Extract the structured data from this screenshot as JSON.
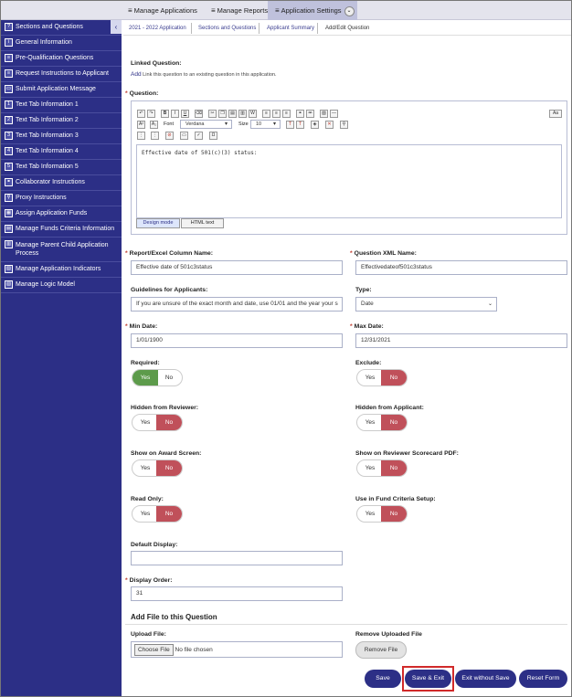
{
  "nav": {
    "tabs": [
      {
        "label": "Manage Applications"
      },
      {
        "label": "Manage Reports"
      },
      {
        "label": "Application Settings"
      }
    ]
  },
  "sidebar": {
    "items": [
      {
        "label": "Sections and Questions",
        "icon": "?"
      },
      {
        "label": "General Information",
        "icon": "i"
      },
      {
        "label": "Pre-Qualification Questions",
        "icon": "≡"
      },
      {
        "label": "Request Instructions to Applicant",
        "icon": "≡"
      },
      {
        "label": "Submit Application Message",
        "icon": "▭"
      },
      {
        "label": "Text Tab Information 1",
        "icon": "1"
      },
      {
        "label": "Text Tab Information 2",
        "icon": "2"
      },
      {
        "label": "Text Tab Information 3",
        "icon": "3"
      },
      {
        "label": "Text Tab Information 4",
        "icon": "4"
      },
      {
        "label": "Text Tab Information 5",
        "icon": "5"
      },
      {
        "label": "Collaborator Instructions",
        "icon": "⚭"
      },
      {
        "label": "Proxy Instructions",
        "icon": "⚲"
      },
      {
        "label": "Assign Application Funds",
        "icon": "▦"
      },
      {
        "label": "Manage Funds Criteria Information",
        "icon": "▤"
      },
      {
        "label": "Manage Parent Child Application Process",
        "icon": "▥"
      },
      {
        "label": "Manage Application Indicators",
        "icon": "▨"
      },
      {
        "label": "Manage Logic Model",
        "icon": "▧"
      }
    ]
  },
  "breadcrumb": [
    "2021 - 2022 Application",
    "Sections and Questions",
    "Applicant Summary",
    "Add/Edit Question"
  ],
  "linked": {
    "label": "Linked Question:",
    "add": "Add",
    "note": "Link this question to an existing question in this application."
  },
  "question": {
    "label": "Question:",
    "text": "Effective date of 501(c)(3) status:",
    "font": "Verdana",
    "size": "10",
    "font_label": "Font",
    "size_label": "Size",
    "design_mode": "Design mode",
    "html_text": "HTML text",
    "aa": "Aa"
  },
  "fields": {
    "report_label": "Report/Excel Column Name:",
    "report_value": "Effective date of 501c3status",
    "xml_label": "Question XML Name:",
    "xml_value": "Effectivedateof501c3status",
    "guide_label": "Guidelines for Applicants:",
    "guide_value": "If you are unsure of the exact month and date, use 01/01 and the year your s",
    "type_label": "Type:",
    "type_value": "Date",
    "min_label": "Min Date:",
    "min_value": "1/01/1900",
    "max_label": "Max Date:",
    "max_value": "12/31/2021",
    "default_label": "Default Display:",
    "default_value": "",
    "order_label": "Display Order:",
    "order_value": "31"
  },
  "toggles": {
    "yes": "Yes",
    "no": "No",
    "required": "Required:",
    "exclude": "Exclude:",
    "hidden_reviewer": "Hidden from Reviewer:",
    "hidden_applicant": "Hidden from Applicant:",
    "award": "Show on Award Screen:",
    "scorecard": "Show on Reviewer Scorecard PDF:",
    "readonly": "Read Only:",
    "fund_criteria": "Use in Fund Criteria Setup:"
  },
  "file": {
    "heading": "Add File to this Question",
    "upload_label": "Upload File:",
    "choose": "Choose File",
    "none": "No file chosen",
    "remove_label": "Remove Uploaded File",
    "remove_btn": "Remove File"
  },
  "actions": {
    "save": "Save",
    "save_exit": "Save & Exit",
    "exit": "Exit without Save",
    "reset": "Reset Form"
  }
}
